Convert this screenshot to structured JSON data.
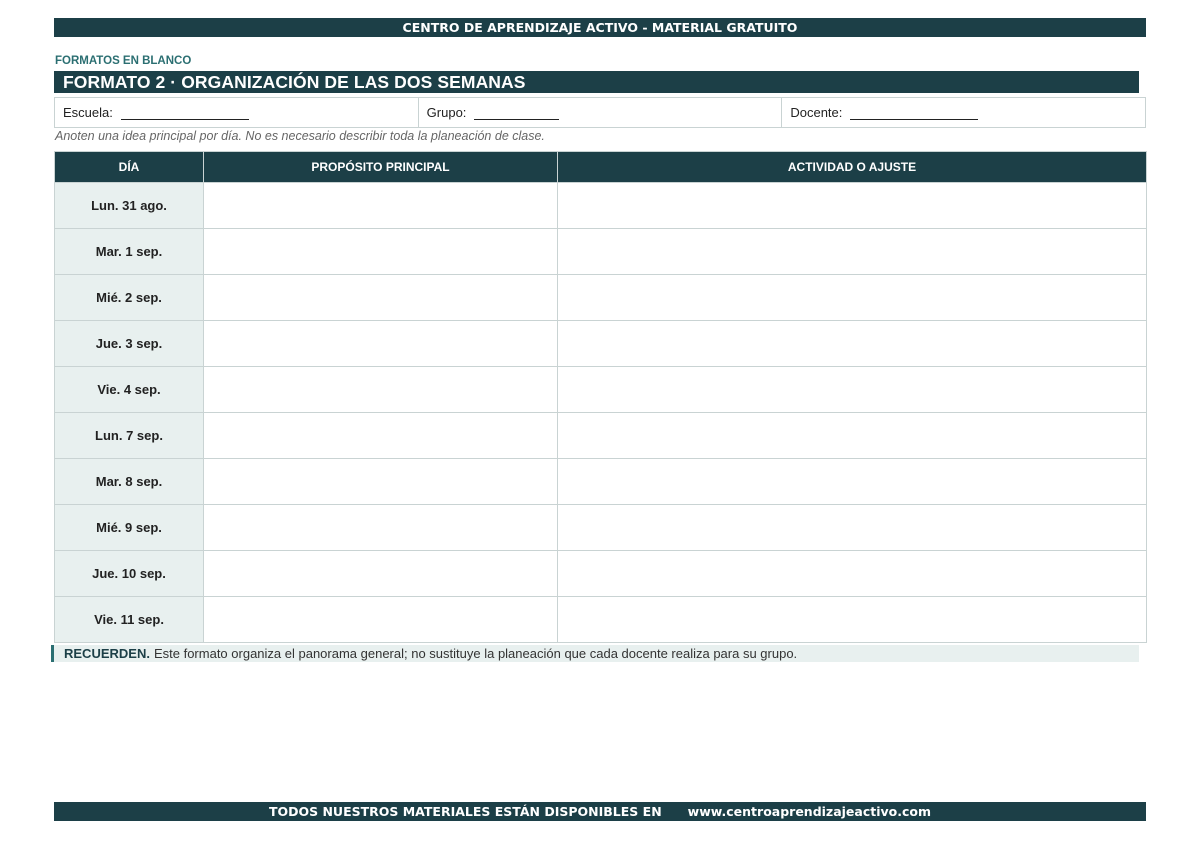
{
  "header": {
    "banner": "CENTRO DE APRENDIZAJE ACTIVO - MATERIAL GRATUITO"
  },
  "section_label": "FORMATOS EN BLANCO",
  "title": "FORMATO 2 · ORGANIZACIÓN DE LAS DOS SEMANAS",
  "info": {
    "school_label": "Escuela:",
    "group_label": "Grupo:",
    "teacher_label": "Docente:"
  },
  "note": "Anoten una idea principal por día. No es necesario describir toda la planeación de clase.",
  "table": {
    "headers": [
      "DÍA",
      "PROPÓSITO PRINCIPAL",
      "ACTIVIDAD O AJUSTE"
    ],
    "rows": [
      {
        "day": "Lun. 31 ago.",
        "purpose": "",
        "activity": ""
      },
      {
        "day": "Mar. 1 sep.",
        "purpose": "",
        "activity": ""
      },
      {
        "day": "Mié. 2 sep.",
        "purpose": "",
        "activity": ""
      },
      {
        "day": "Jue. 3 sep.",
        "purpose": "",
        "activity": ""
      },
      {
        "day": "Vie. 4 sep.",
        "purpose": "",
        "activity": ""
      },
      {
        "day": "Lun. 7 sep.",
        "purpose": "",
        "activity": ""
      },
      {
        "day": "Mar. 8 sep.",
        "purpose": "",
        "activity": ""
      },
      {
        "day": "Mié. 9 sep.",
        "purpose": "",
        "activity": ""
      },
      {
        "day": "Jue. 10 sep.",
        "purpose": "",
        "activity": ""
      },
      {
        "day": "Vie. 11 sep.",
        "purpose": "",
        "activity": ""
      }
    ]
  },
  "reminder": {
    "label": "RECUERDEN.",
    "text": "Este formato organiza el panorama general; no sustituye la planeación que cada docente realiza para su grupo."
  },
  "footer": {
    "text": "TODOS NUESTROS MATERIALES ESTÁN DISPONIBLES EN",
    "url": "www.centroaprendizajeactivo.com"
  },
  "colors": {
    "primary": "#1c3f47",
    "accent": "#2b6f72",
    "day_cell": "#e8f0ef",
    "border": "#c9d3d3"
  }
}
